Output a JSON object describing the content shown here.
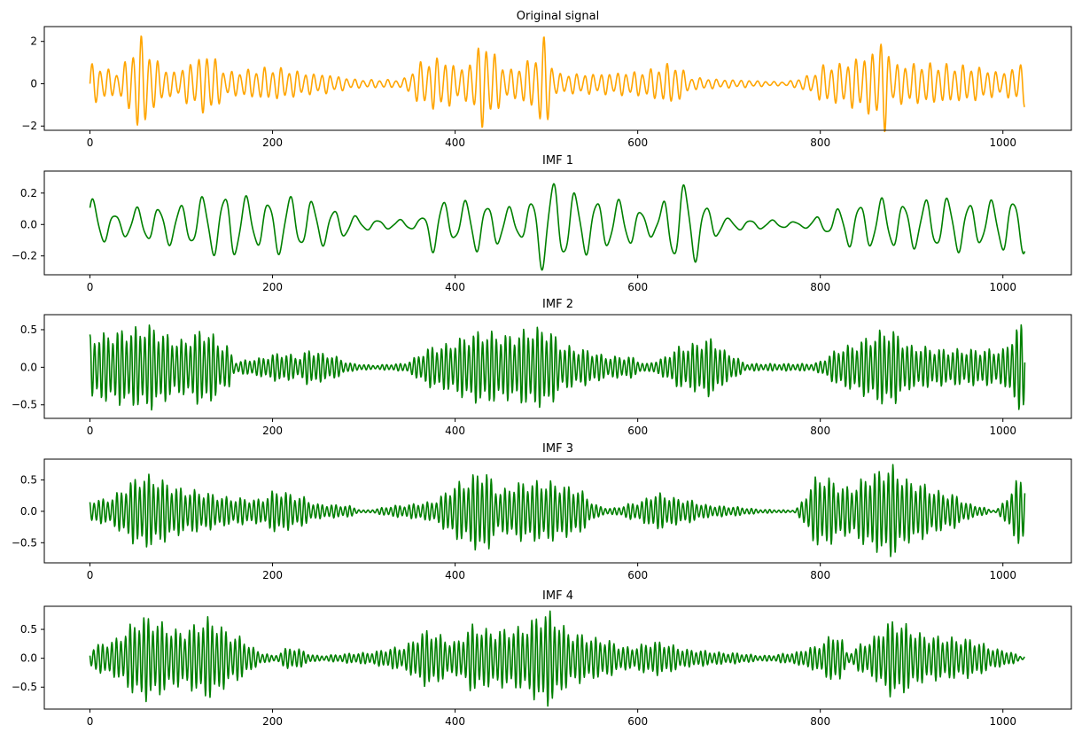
{
  "colors": {
    "signal": "#ffa500",
    "imf": "#008000",
    "axes": "#000000",
    "background": "#ffffff"
  },
  "chart_data": [
    {
      "type": "line",
      "title": "Original signal",
      "series": [
        {
          "color": "#ffa500",
          "amplitude_envelope_x": [
            0,
            30,
            55,
            60,
            70,
            90,
            125,
            130,
            150,
            200,
            250,
            300,
            340,
            365,
            380,
            410,
            430,
            460,
            480,
            500,
            510,
            550,
            600,
            640,
            660,
            700,
            760,
            790,
            800,
            820,
            850,
            870,
            880,
            920,
            960,
            1000,
            1024
          ],
          "amplitude_envelope_y": [
            1.0,
            0.6,
            2.3,
            2.3,
            1.2,
            0.6,
            1.4,
            1.6,
            0.6,
            0.8,
            0.5,
            0.2,
            0.2,
            1.1,
            1.3,
            0.8,
            2.1,
            0.7,
            1.1,
            2.3,
            0.5,
            0.5,
            0.6,
            1.0,
            0.3,
            0.2,
            0.1,
            0.4,
            0.9,
            1.0,
            1.4,
            2.3,
            1.0,
            1.0,
            0.9,
            0.6,
            1.1
          ],
          "mean_period": 9
        }
      ],
      "xlim": [
        -50,
        1075
      ],
      "ylim": [
        -2.2,
        2.7
      ],
      "xticks": [
        0,
        200,
        400,
        600,
        800,
        1000
      ],
      "yticks": [
        -2,
        0,
        2
      ]
    },
    {
      "type": "line",
      "title": "IMF 1",
      "series": [
        {
          "color": "#008000",
          "amplitude_envelope_x": [
            0,
            30,
            60,
            100,
            130,
            155,
            180,
            210,
            240,
            270,
            300,
            330,
            360,
            380,
            400,
            420,
            440,
            470,
            500,
            510,
            540,
            580,
            620,
            640,
            650,
            660,
            680,
            700,
            740,
            780,
            800,
            840,
            870,
            900,
            940,
            980,
            1010,
            1024
          ],
          "amplitude_envelope_y": [
            0.17,
            0.08,
            0.12,
            0.14,
            0.2,
            0.24,
            0.16,
            0.2,
            0.17,
            0.11,
            0.04,
            0.03,
            0.04,
            0.2,
            0.12,
            0.19,
            0.15,
            0.1,
            0.31,
            0.29,
            0.2,
            0.16,
            0.08,
            0.28,
            0.3,
            0.25,
            0.12,
            0.04,
            0.03,
            0.02,
            0.06,
            0.16,
            0.17,
            0.16,
            0.19,
            0.15,
            0.2,
            0.2
          ],
          "mean_period": 24
        }
      ],
      "xlim": [
        -50,
        1075
      ],
      "ylim": [
        -0.32,
        0.34
      ],
      "xticks": [
        0,
        200,
        400,
        600,
        800,
        1000
      ],
      "yticks": [
        -0.2,
        0.0,
        0.2
      ]
    },
    {
      "type": "line",
      "title": "IMF 2",
      "series": [
        {
          "color": "#008000",
          "amplitude_envelope_x": [
            0,
            55,
            60,
            100,
            125,
            150,
            160,
            180,
            210,
            230,
            240,
            260,
            290,
            310,
            340,
            380,
            430,
            460,
            485,
            500,
            520,
            540,
            570,
            590,
            610,
            620,
            650,
            680,
            700,
            720,
            760,
            790,
            830,
            860,
            870,
            880,
            900,
            940,
            1000,
            1015,
            1024
          ],
          "amplitude_envelope_y": [
            0.45,
            0.55,
            0.6,
            0.38,
            0.53,
            0.3,
            0.08,
            0.12,
            0.2,
            0.15,
            0.25,
            0.18,
            0.05,
            0.03,
            0.05,
            0.3,
            0.5,
            0.45,
            0.55,
            0.55,
            0.3,
            0.25,
            0.15,
            0.15,
            0.05,
            0.1,
            0.3,
            0.4,
            0.2,
            0.05,
            0.05,
            0.05,
            0.3,
            0.45,
            0.55,
            0.5,
            0.3,
            0.25,
            0.25,
            0.55,
            0.65
          ],
          "mean_period": 5
        }
      ],
      "xlim": [
        -50,
        1075
      ],
      "ylim": [
        -0.68,
        0.7
      ],
      "xticks": [
        0,
        200,
        400,
        600,
        800,
        1000
      ],
      "yticks": [
        -0.5,
        0.0,
        0.5
      ]
    },
    {
      "type": "line",
      "title": "IMF 3",
      "series": [
        {
          "color": "#008000",
          "amplitude_envelope_x": [
            0,
            15,
            60,
            110,
            160,
            185,
            205,
            230,
            250,
            280,
            300,
            340,
            370,
            410,
            430,
            450,
            470,
            500,
            530,
            560,
            570,
            600,
            620,
            650,
            680,
            700,
            740,
            770,
            800,
            830,
            860,
            875,
            900,
            940,
            970,
            990,
            1024
          ],
          "amplitude_envelope_y": [
            0.2,
            0.2,
            0.6,
            0.35,
            0.22,
            0.2,
            0.35,
            0.25,
            0.12,
            0.1,
            0.02,
            0.1,
            0.15,
            0.5,
            0.7,
            0.35,
            0.48,
            0.5,
            0.4,
            0.08,
            0.05,
            0.15,
            0.3,
            0.2,
            0.1,
            0.08,
            0.03,
            0.02,
            0.6,
            0.4,
            0.65,
            0.77,
            0.5,
            0.3,
            0.1,
            0.02,
            0.6
          ],
          "mean_period": 5
        }
      ],
      "xlim": [
        -50,
        1075
      ],
      "ylim": [
        -0.82,
        0.83
      ],
      "xticks": [
        0,
        200,
        400,
        600,
        800,
        1000
      ],
      "yticks": [
        -0.5,
        0.0,
        0.5
      ]
    },
    {
      "type": "line",
      "title": "IMF 4",
      "series": [
        {
          "color": "#008000",
          "amplitude_envelope_x": [
            0,
            20,
            60,
            100,
            130,
            160,
            190,
            200,
            220,
            250,
            300,
            340,
            370,
            400,
            420,
            440,
            470,
            500,
            530,
            560,
            590,
            620,
            660,
            700,
            740,
            770,
            790,
            820,
            830,
            850,
            880,
            920,
            960,
            1000,
            1024
          ],
          "amplitude_envelope_y": [
            0.2,
            0.3,
            0.75,
            0.5,
            0.72,
            0.4,
            0.1,
            0.05,
            0.2,
            0.05,
            0.1,
            0.2,
            0.5,
            0.3,
            0.6,
            0.5,
            0.55,
            0.85,
            0.45,
            0.35,
            0.2,
            0.3,
            0.15,
            0.1,
            0.05,
            0.1,
            0.2,
            0.45,
            0.1,
            0.3,
            0.68,
            0.4,
            0.35,
            0.15,
            0.03
          ],
          "mean_period": 5
        }
      ],
      "xlim": [
        -50,
        1075
      ],
      "ylim": [
        -0.88,
        0.9
      ],
      "xticks": [
        0,
        200,
        400,
        600,
        800,
        1000
      ],
      "yticks": [
        -0.5,
        0.0,
        0.5
      ]
    }
  ]
}
